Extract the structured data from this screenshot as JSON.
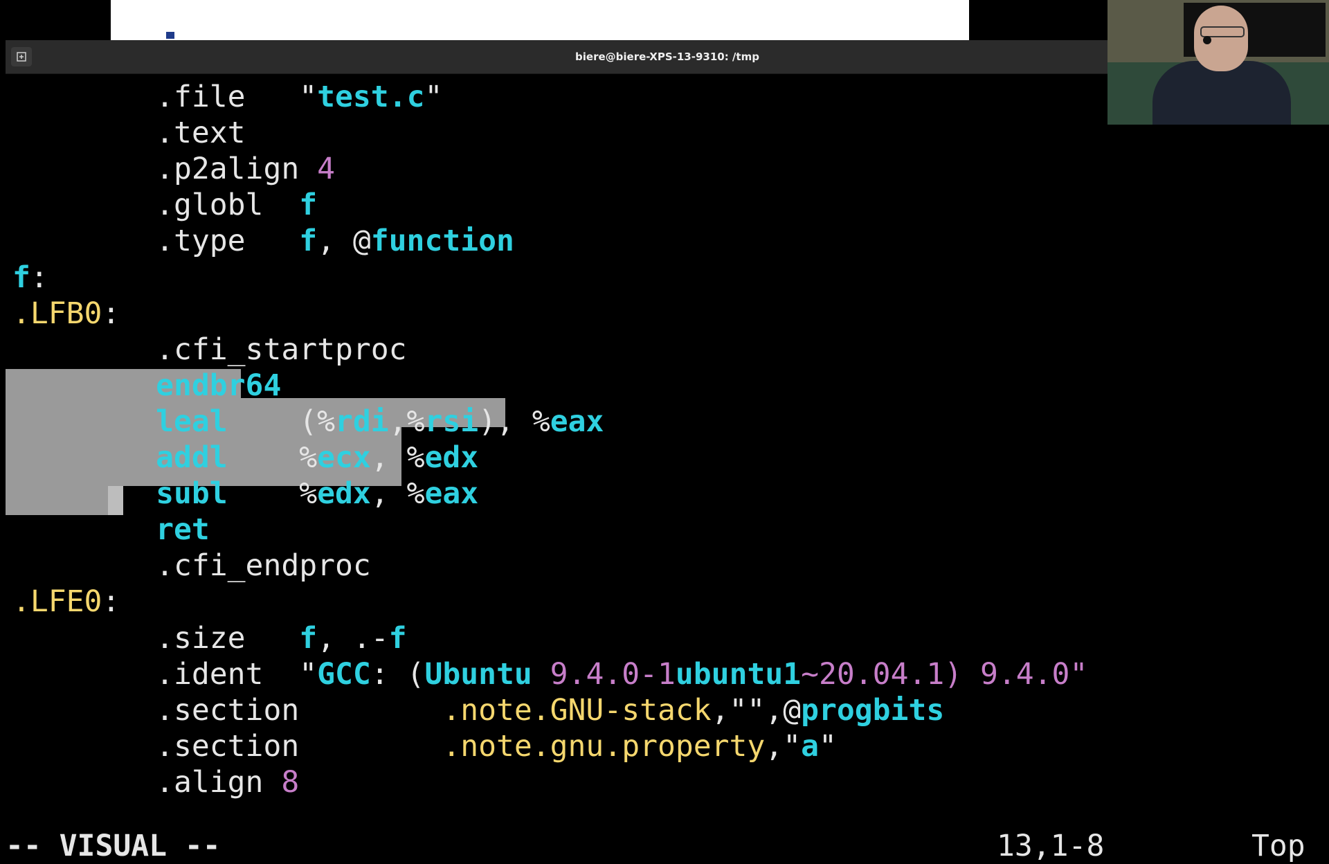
{
  "window": {
    "title": "biere@biere-XPS-13-9310: /tmp"
  },
  "colors": {
    "yellow": "#f5d76e",
    "cyan": "#2fd0e0",
    "magenta": "#c77ec9",
    "selection": "#9a9a9a"
  },
  "lines": [
    [
      "        ",
      ".file",
      "   \"",
      "test.c",
      "\""
    ],
    [
      "        ",
      ".text"
    ],
    [
      "        ",
      ".p2align ",
      "4"
    ],
    [
      "        ",
      ".globl  ",
      "f"
    ],
    [
      "        ",
      ".type   ",
      "f",
      ", @",
      "function"
    ],
    [
      "f",
      ":"
    ],
    [
      ".LFB0",
      ":"
    ],
    [
      "        ",
      ".cfi_startproc"
    ],
    [
      "        ",
      "endbr64"
    ],
    [
      "        ",
      "leal",
      "    (",
      "%",
      "rdi",
      ",",
      "%",
      "rsi",
      "), ",
      "%",
      "eax"
    ],
    [
      "        ",
      "addl",
      "    ",
      "%",
      "ecx",
      ", ",
      "%",
      "edx"
    ],
    [
      "        ",
      "subl",
      "    ",
      "%",
      "edx",
      ", ",
      "%",
      "eax"
    ],
    [
      "        ",
      "ret"
    ],
    [
      "        ",
      ".cfi_endproc"
    ],
    [
      ".LFE0",
      ":"
    ],
    [
      "        ",
      ".size   ",
      "f",
      ", .-",
      "f"
    ],
    [
      "        ",
      ".ident  ",
      "\"",
      "GCC",
      ": (",
      "Ubuntu",
      " 9.4.0-1",
      "ubuntu1",
      "~20.04.1) 9.4.0\""
    ],
    [
      "        ",
      ".section        ",
      ".note.GNU-stack",
      ",\"\",@",
      "progbits"
    ],
    [
      "        ",
      ".section        ",
      ".note.gnu.property",
      ",\"",
      "a",
      "\""
    ],
    [
      "        ",
      ".align ",
      "8"
    ]
  ],
  "status": {
    "mode": "-- VISUAL --",
    "position": "13,1-8",
    "scroll": "Top"
  }
}
